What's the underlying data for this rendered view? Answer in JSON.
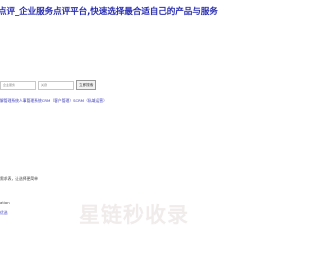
{
  "header": {
    "headline": "点评_企业服务点评平台,快速选择最合适自己的产品与服务"
  },
  "search": {
    "placeholder_1": "企业服务",
    "placeholder_2": "关键",
    "button_label": "立即搜索"
  },
  "categories_line": "解管理系统人事管理系统CRM（客户管理）SCRM（私域运营）",
  "hint_text": "需求表，让选择更简单",
  "label_ation": "ation",
  "small_link": "优选",
  "watermark": "星链秒收录"
}
